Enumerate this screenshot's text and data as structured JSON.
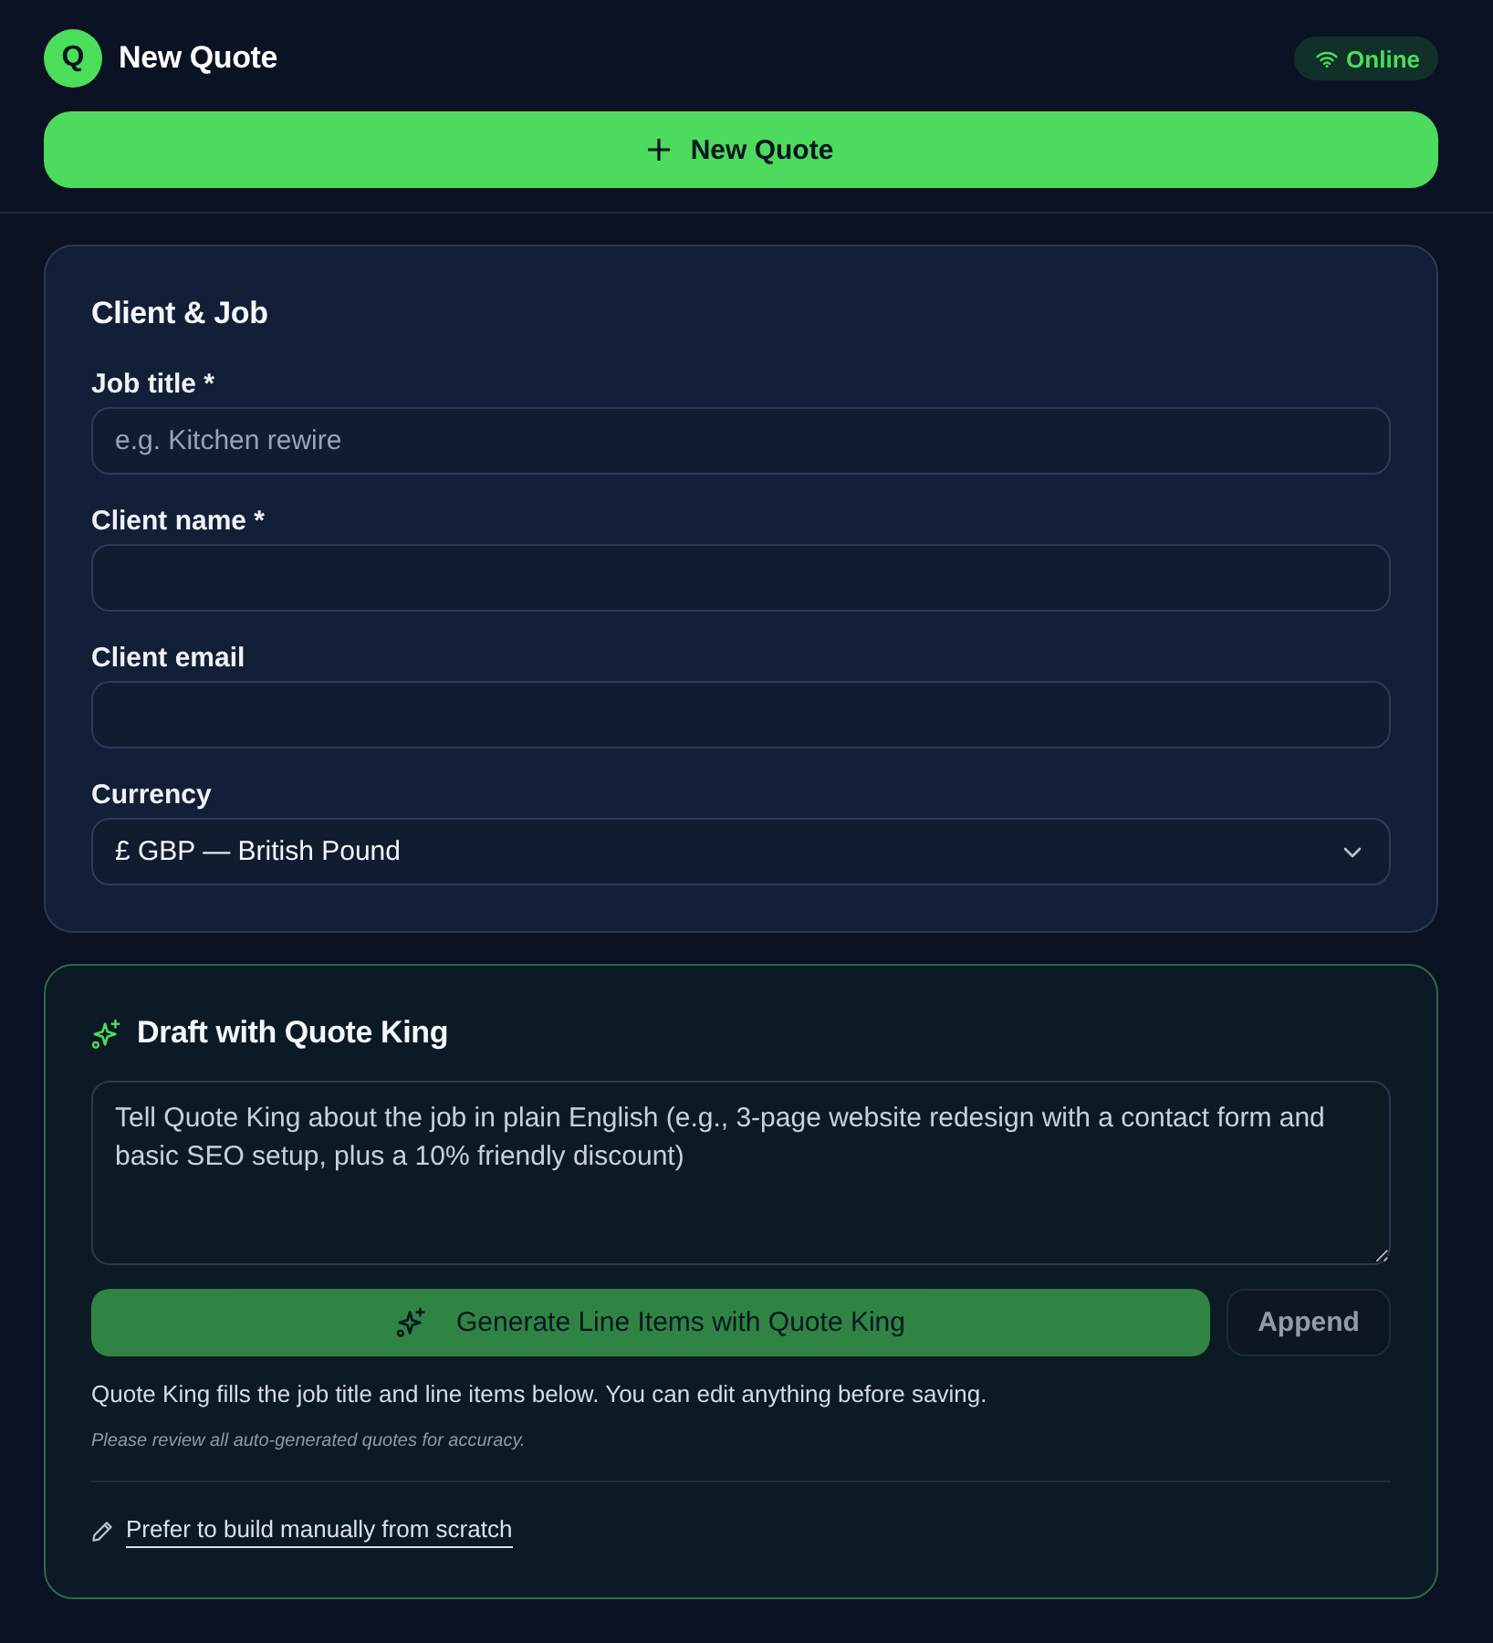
{
  "header": {
    "logo_letter": "Q",
    "title": "New Quote",
    "status": {
      "label": "Online"
    }
  },
  "new_button": {
    "label": "New Quote"
  },
  "client_card": {
    "title": "Client & Job",
    "fields": [
      {
        "kind": "text",
        "label": "Job title *",
        "placeholder": "e.g. Kitchen rewire"
      },
      {
        "kind": "text",
        "label": "Client name *"
      },
      {
        "kind": "text",
        "label": "Client email"
      },
      {
        "kind": "select",
        "label": "Currency",
        "value": "£ GBP — British Pound"
      }
    ]
  },
  "draft_card": {
    "title": "Draft with Quote King",
    "prompt": {
      "placeholder": "Tell Quote King about the job in plain English (e.g., 3-page website redesign with a contact form and basic SEO setup, plus a 10% friendly discount)"
    },
    "buttons": [
      {
        "kind": "primary",
        "label": "Generate Line Items with Quote King",
        "disabled": true
      },
      {
        "kind": "secondary",
        "label": "Append",
        "disabled": true
      }
    ],
    "helper_text": "Quote King fills the job title and line items below. You can edit anything before saving.",
    "disclaimer": "Please review all auto-generated quotes for accuracy.",
    "manual_link": "Prefer to build manually from scratch"
  }
}
